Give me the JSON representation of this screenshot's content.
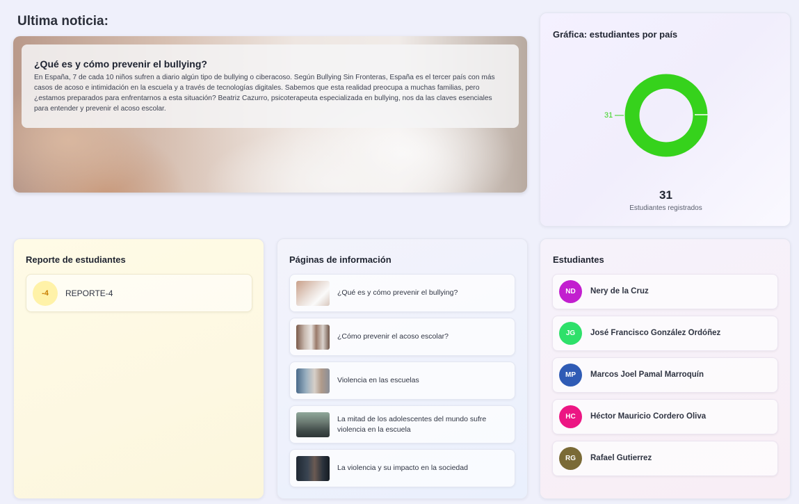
{
  "news": {
    "section_title": "Ultima noticia:",
    "headline": "¿Qué es y cómo prevenir el bullying?",
    "body": "En España, 7 de cada 10 niños sufren a diario algún tipo de bullying o ciberacoso. Según Bullying Sin Fronteras, España es el tercer país con más casos de acoso e intimidación en la escuela y a través de tecnologías digitales. Sabemos que esta realidad preocupa a muchas familias, pero ¿estamos preparados para enfrentarnos a esta situación? Beatriz Cazurro, psicoterapeuta especializada en bullying, nos da las claves esenciales para entender y prevenir el acoso escolar."
  },
  "chart": {
    "title": "Gráfica: estudiantes por país",
    "total": "31",
    "total_label": "Estudiantes registrados",
    "ring_color": "#36d21c"
  },
  "chart_data": {
    "type": "pie",
    "donut": true,
    "title": "Gráfica: estudiantes por país",
    "slices": [
      {
        "label": "31",
        "value": 31,
        "color": "#36d21c"
      }
    ]
  },
  "report": {
    "title": "Reporte de estudiantes",
    "items": [
      {
        "badge": "-4",
        "label": "REPORTE-4"
      }
    ]
  },
  "pages": {
    "title": "Páginas de información",
    "items": [
      {
        "label": "¿Qué es y cómo prevenir el bullying?"
      },
      {
        "label": "¿Cómo prevenir el acoso escolar?"
      },
      {
        "label": "Violencia en las escuelas"
      },
      {
        "label": "La mitad de los adolescentes del mundo sufre violencia en la escuela"
      },
      {
        "label": "La violencia y su impacto en la sociedad"
      }
    ]
  },
  "students": {
    "title": "Estudiantes",
    "items": [
      {
        "initials": "ND",
        "name": "Nery de la Cruz",
        "color": "#c21fcf"
      },
      {
        "initials": "JG",
        "name": "José Francisco González Ordóñez",
        "color": "#2ee06a"
      },
      {
        "initials": "MP",
        "name": "Marcos Joel Pamal Marroquín",
        "color": "#2f5bb5"
      },
      {
        "initials": "HC",
        "name": "Héctor Mauricio Cordero Oliva",
        "color": "#ec1683"
      },
      {
        "initials": "RG",
        "name": "Rafael Gutierrez",
        "color": "#7a6a36"
      }
    ]
  }
}
